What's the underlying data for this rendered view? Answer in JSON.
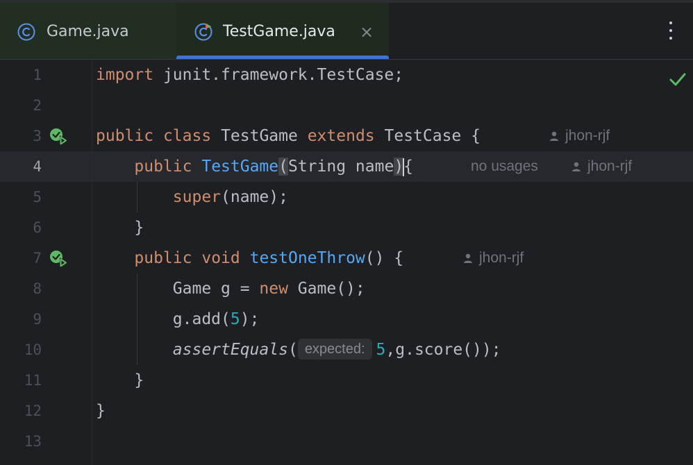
{
  "tabs": [
    {
      "label": "Game.java",
      "active": false,
      "icon": "java-class-icon"
    },
    {
      "label": "TestGame.java",
      "active": true,
      "icon": "java-test-class-icon",
      "close": "×"
    }
  ],
  "colors": {
    "background": "#1e1f22",
    "keyword": "#cf8e6d",
    "function": "#56a8f5",
    "number": "#2aacb8",
    "text": "#bcbec4",
    "tab_indicator": "#3d72d7",
    "check": "#5fb865"
  },
  "editor": {
    "line_numbers": [
      "1",
      "2",
      "3",
      "4",
      "5",
      "6",
      "7",
      "8",
      "9",
      "10",
      "11",
      "12",
      "13"
    ],
    "current_line": 4,
    "code": {
      "l1": {
        "kw_import": "import",
        "rest": " junit.framework.TestCase;"
      },
      "l3": {
        "kw_public": "public",
        "kw_class": "class",
        "name": "TestGame",
        "kw_extends": "extends",
        "type": "TestCase {"
      },
      "l4": {
        "kw_public": "public",
        "fn": "TestGame",
        "open_paren": "(",
        "params": "String name",
        "close_paren": ")",
        "brace": "{"
      },
      "l5": {
        "kw_super": "super",
        "rest": "(name);"
      },
      "l6": {
        "text": "}"
      },
      "l7": {
        "kw_public": "public",
        "kw_void": "void",
        "fn": "testOneThrow",
        "rest": "() {"
      },
      "l8": {
        "a": "Game g = ",
        "kw_new": "new",
        "b": " Game();"
      },
      "l9": {
        "a": "g.add(",
        "num": "5",
        "b": ");"
      },
      "l10": {
        "fn": "assertEquals",
        "open": "(",
        "inlay": "expected:",
        "num": "5",
        "rest": ",g.score());"
      },
      "l11": {
        "text": "}"
      },
      "l12": {
        "text": "}"
      }
    },
    "hints": {
      "l3_author": "jhon-rjf",
      "l4_usages": "no usages",
      "l4_author": "jhon-rjf",
      "l7_author": "jhon-rjf"
    },
    "status_icon": "check-icon"
  }
}
